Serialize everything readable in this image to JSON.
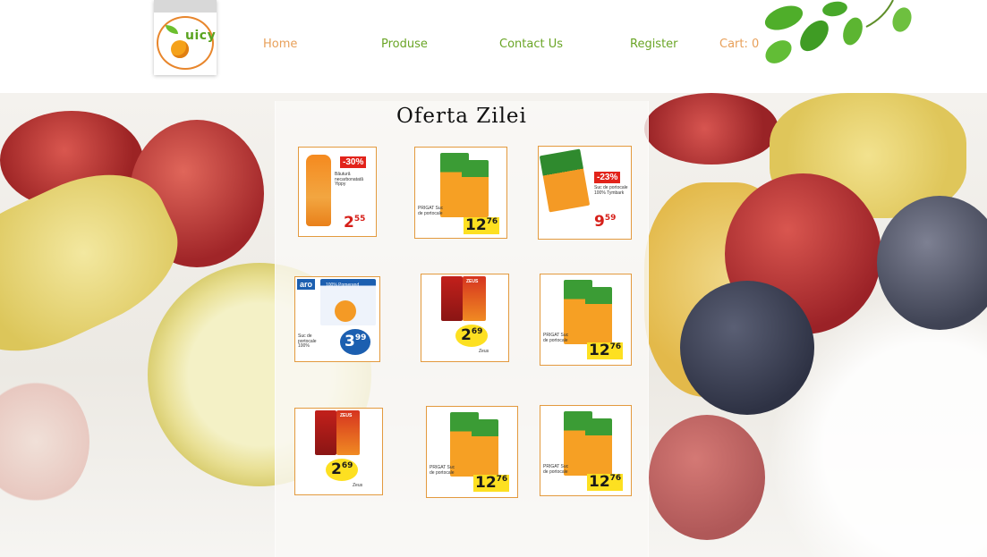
{
  "brand": {
    "logo_text": "uicy"
  },
  "nav": {
    "home": "Home",
    "produse": "Produse",
    "contact": "Contact Us",
    "register": "Register",
    "cart": "Cart: 0"
  },
  "colors": {
    "nav_orange": "#e8a05a",
    "nav_green": "#6aa526",
    "border": "#e39a3e"
  },
  "main": {
    "title": "Oferta Zilei",
    "products": [
      {
        "price_int": "2",
        "price_dec": "55",
        "discount": "-30%",
        "name": "Băutură necarbonatată Yippy"
      },
      {
        "price_int": "12",
        "price_dec": "76",
        "name": "PRIGAT Suc de portocale"
      },
      {
        "price_int": "9",
        "price_dec": "59",
        "discount": "-23%",
        "name": "Suc de portocale 100% Tymbark"
      },
      {
        "price_int": "3",
        "price_dec": "99",
        "name": "Suc de portocale 100%",
        "brand": "aro",
        "label": "100% Pomerand"
      },
      {
        "price_int": "2",
        "price_dec": "69",
        "name": "Zeus",
        "brand": "ZEUS"
      },
      {
        "price_int": "12",
        "price_dec": "76",
        "name": "PRIGAT Suc de portocale"
      },
      {
        "price_int": "2",
        "price_dec": "69",
        "name": "Zeus",
        "brand": "ZEUS"
      },
      {
        "price_int": "12",
        "price_dec": "76",
        "name": "PRIGAT Suc de portocale"
      },
      {
        "price_int": "12",
        "price_dec": "76",
        "name": "PRIGAT Suc de portocale"
      }
    ]
  }
}
